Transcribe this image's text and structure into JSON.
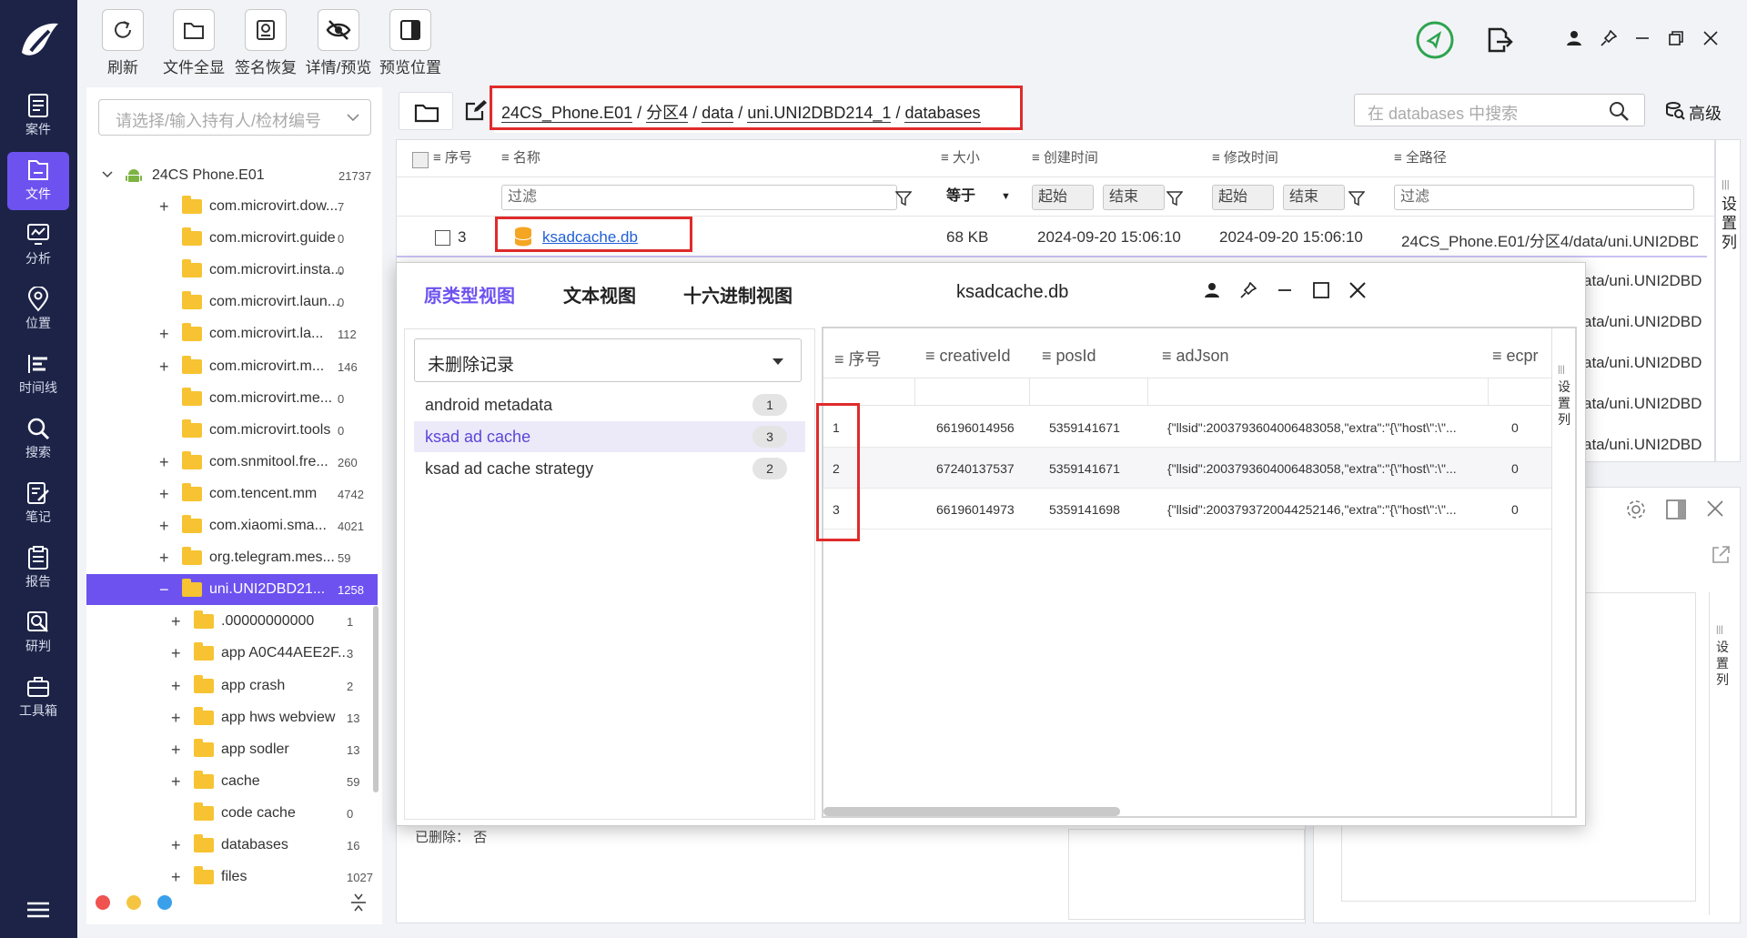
{
  "toolbar": {
    "refresh": "刷新",
    "file_overview": "文件全显",
    "signature_restore": "签名恢复",
    "details_preview": "详情/预览",
    "preview_position": "预览位置"
  },
  "nav": {
    "case": "案件",
    "file": "文件",
    "analysis": "分析",
    "location": "位置",
    "timeline": "时间线",
    "search": "搜索",
    "notes": "笔记",
    "report": "报告",
    "judge": "研判",
    "toolbox": "工具箱"
  },
  "holder_select": {
    "placeholder": "请选择/输入持有人/检材编号"
  },
  "tree": {
    "root": {
      "label": "24CS Phone.E01",
      "count": "21737"
    },
    "items": [
      {
        "label": "com.microvirt.dow...",
        "count": "7",
        "expand": "+"
      },
      {
        "label": "com.microvirt.guide",
        "count": "0",
        "expand": ""
      },
      {
        "label": "com.microvirt.insta...",
        "count": "0",
        "expand": ""
      },
      {
        "label": "com.microvirt.laun...",
        "count": "0",
        "expand": ""
      },
      {
        "label": "com.microvirt.la...",
        "count": "112",
        "expand": "+"
      },
      {
        "label": "com.microvirt.m...",
        "count": "146",
        "expand": "+"
      },
      {
        "label": "com.microvirt.me...",
        "count": "0",
        "expand": ""
      },
      {
        "label": "com.microvirt.tools",
        "count": "0",
        "expand": ""
      },
      {
        "label": "com.snmitool.fre...",
        "count": "260",
        "expand": "+"
      },
      {
        "label": "com.tencent.mm",
        "count": "4742",
        "expand": "+"
      },
      {
        "label": "com.xiaomi.sma...",
        "count": "4021",
        "expand": "+"
      },
      {
        "label": "org.telegram.mes...",
        "count": "59",
        "expand": "+"
      },
      {
        "label": "uni.UNI2DBD21...",
        "count": "1258",
        "expand": "−"
      }
    ],
    "children": [
      {
        "label": ".00000000000",
        "count": "1",
        "expand": "+"
      },
      {
        "label": "app A0C44AEE2F...",
        "count": "3",
        "expand": "+"
      },
      {
        "label": "app crash",
        "count": "2",
        "expand": "+"
      },
      {
        "label": "app hws webview",
        "count": "13",
        "expand": "+"
      },
      {
        "label": "app sodler",
        "count": "13",
        "expand": "+"
      },
      {
        "label": "cache",
        "count": "59",
        "expand": "+"
      },
      {
        "label": "code cache",
        "count": "0",
        "expand": ""
      },
      {
        "label": "databases",
        "count": "16",
        "expand": "+"
      },
      {
        "label": "files",
        "count": "1027",
        "expand": "+"
      }
    ]
  },
  "breadcrumb": {
    "p1": "24CS_Phone.E01",
    "p2": "分区4",
    "p3": "data",
    "p4": "uni.UNI2DBD214_1",
    "p5": "databases",
    "sep": "/"
  },
  "search": {
    "placeholder": "在 databases 中搜索",
    "advanced": "高级"
  },
  "file_table": {
    "headers": {
      "seq": "序号",
      "name": "名称",
      "size": "大小",
      "created": "创建时间",
      "modified": "修改时间",
      "fullpath": "全路径"
    },
    "filter": {
      "filter": "过滤",
      "equals": "等于",
      "start": "起始",
      "end": "结束"
    },
    "row": {
      "seq": "3",
      "name": "ksadcache.db",
      "size": "68 KB",
      "created": "2024-09-20 15:06:10",
      "modified": "2024-09-20 15:06:10",
      "fullpath": "24CS_Phone.E01/分区4/data/uni.UNI2DBD"
    },
    "path_tails": [
      "ata/uni.UNI2DBD",
      "ata/uni.UNI2DBD",
      "ata/uni.UNI2DBD",
      "ata/uni.UNI2DBD",
      "ata/uni.UNI2DBD"
    ],
    "set_columns": "设置列"
  },
  "modal": {
    "tabs": {
      "raw": "原类型视图",
      "text": "文本视图",
      "hex": "十六进制视图"
    },
    "title": "ksadcache.db",
    "record_select": "未删除记录",
    "tables": [
      {
        "name": "android metadata",
        "count": "1"
      },
      {
        "name": "ksad ad cache",
        "count": "3"
      },
      {
        "name": "ksad ad cache strategy",
        "count": "2"
      }
    ],
    "grid": {
      "headers": {
        "seq": "序号",
        "creativeId": "creativeId",
        "posId": "posId",
        "adJson": "adJson",
        "ecpm": "ecpr"
      },
      "rows": [
        {
          "seq": "1",
          "creativeId": "66196014956",
          "posId": "5359141671",
          "adJson": "{\"llsid\":2003793604006483058,\"extra\":\"{\\\"host\\\":\\\"...",
          "ecpm": "0"
        },
        {
          "seq": "2",
          "creativeId": "67240137537",
          "posId": "5359141671",
          "adJson": "{\"llsid\":2003793604006483058,\"extra\":\"{\\\"host\\\":\\\"...",
          "ecpm": "0"
        },
        {
          "seq": "3",
          "creativeId": "66196014973",
          "posId": "5359141698",
          "adJson": "{\"llsid\":2003793720044252146,\"extra\":\"{\\\"host\\\":\\\"...",
          "ecpm": "0"
        }
      ],
      "set_columns": "设置列"
    }
  },
  "bottom": {
    "deleted_label": "已删除：",
    "deleted_value": "否"
  },
  "colors": {
    "accent": "#6d52f0",
    "nav_bg": "#1c2347",
    "highlight_red": "#e02b2b",
    "folder": "#f7c332"
  }
}
